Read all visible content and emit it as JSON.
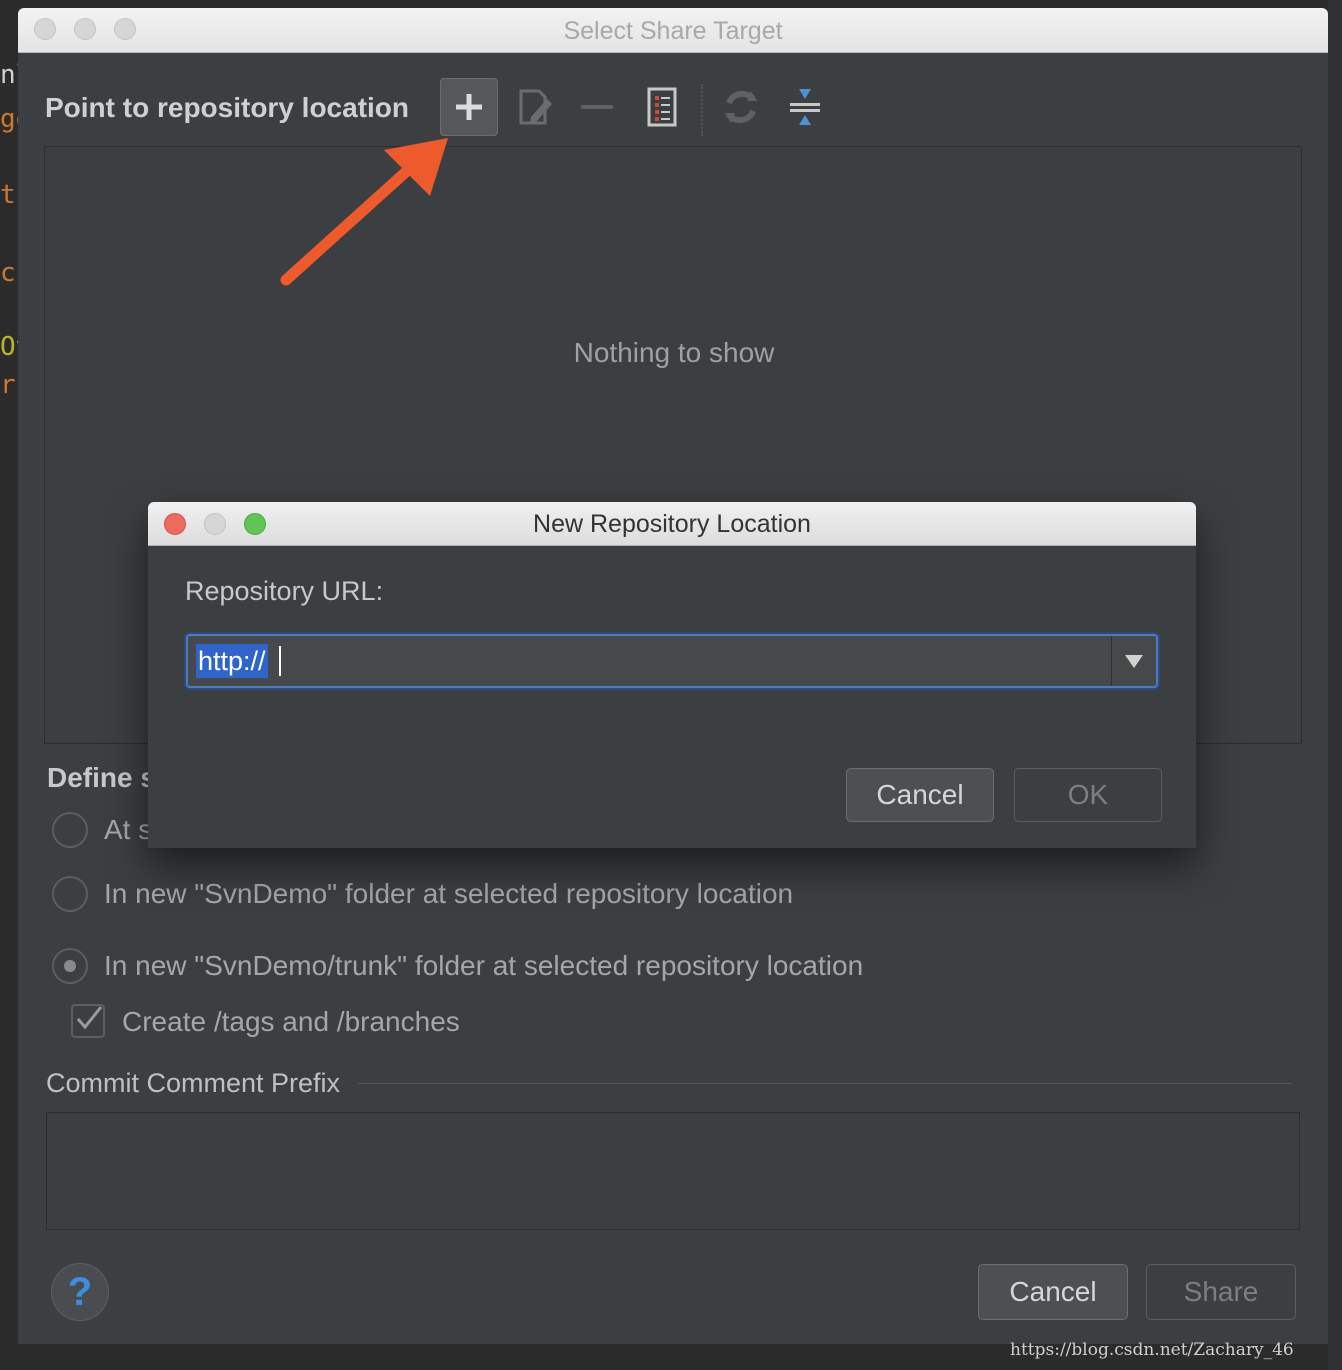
{
  "background_editor": {
    "fragments": [
      {
        "text": "nl",
        "color": "#d0d0d0"
      },
      {
        "text": "ge",
        "color": "#cc7832"
      },
      {
        "text": "t",
        "color": "#cc7832"
      },
      {
        "text": "c",
        "color": "#cc7832"
      },
      {
        "text": "Ov",
        "color": "#bbb529"
      },
      {
        "text": "rc",
        "color": "#cc7832"
      }
    ]
  },
  "window": {
    "title": "Select Share Target"
  },
  "repository": {
    "section_title": "Point to repository location",
    "empty_text": "Nothing to show",
    "toolbar": {
      "add_icon": "plus-icon",
      "edit_icon": "edit-icon",
      "remove_icon": "minus-icon",
      "details_icon": "document-icon",
      "refresh_icon": "refresh-icon",
      "collapse_icon": "collapse-icon"
    }
  },
  "define": {
    "title": "Define s",
    "options": [
      {
        "label": "At s",
        "selected": false
      },
      {
        "label": "In new \"SvnDemo\" folder at selected repository location",
        "selected": false
      },
      {
        "label": "In new \"SvnDemo/trunk\" folder at selected repository location",
        "selected": true
      }
    ],
    "checkbox": {
      "label": "Create /tags and /branches",
      "checked": true
    }
  },
  "commit_prefix": {
    "title": "Commit Comment Prefix",
    "value": ""
  },
  "footer": {
    "help_label": "?",
    "cancel_label": "Cancel",
    "share_label": "Share"
  },
  "modal": {
    "title": "New Repository Location",
    "url_label": "Repository URL:",
    "url_value": "http://",
    "cancel_label": "Cancel",
    "ok_label": "OK"
  },
  "watermark": "https://blog.csdn.net/Zachary_46",
  "colors": {
    "accent_arrow": "#ee5a2c",
    "selection": "#2f65ca",
    "focus_border": "#4d7bbd",
    "traffic_red": "#ed6a5e",
    "traffic_green": "#61c454"
  }
}
